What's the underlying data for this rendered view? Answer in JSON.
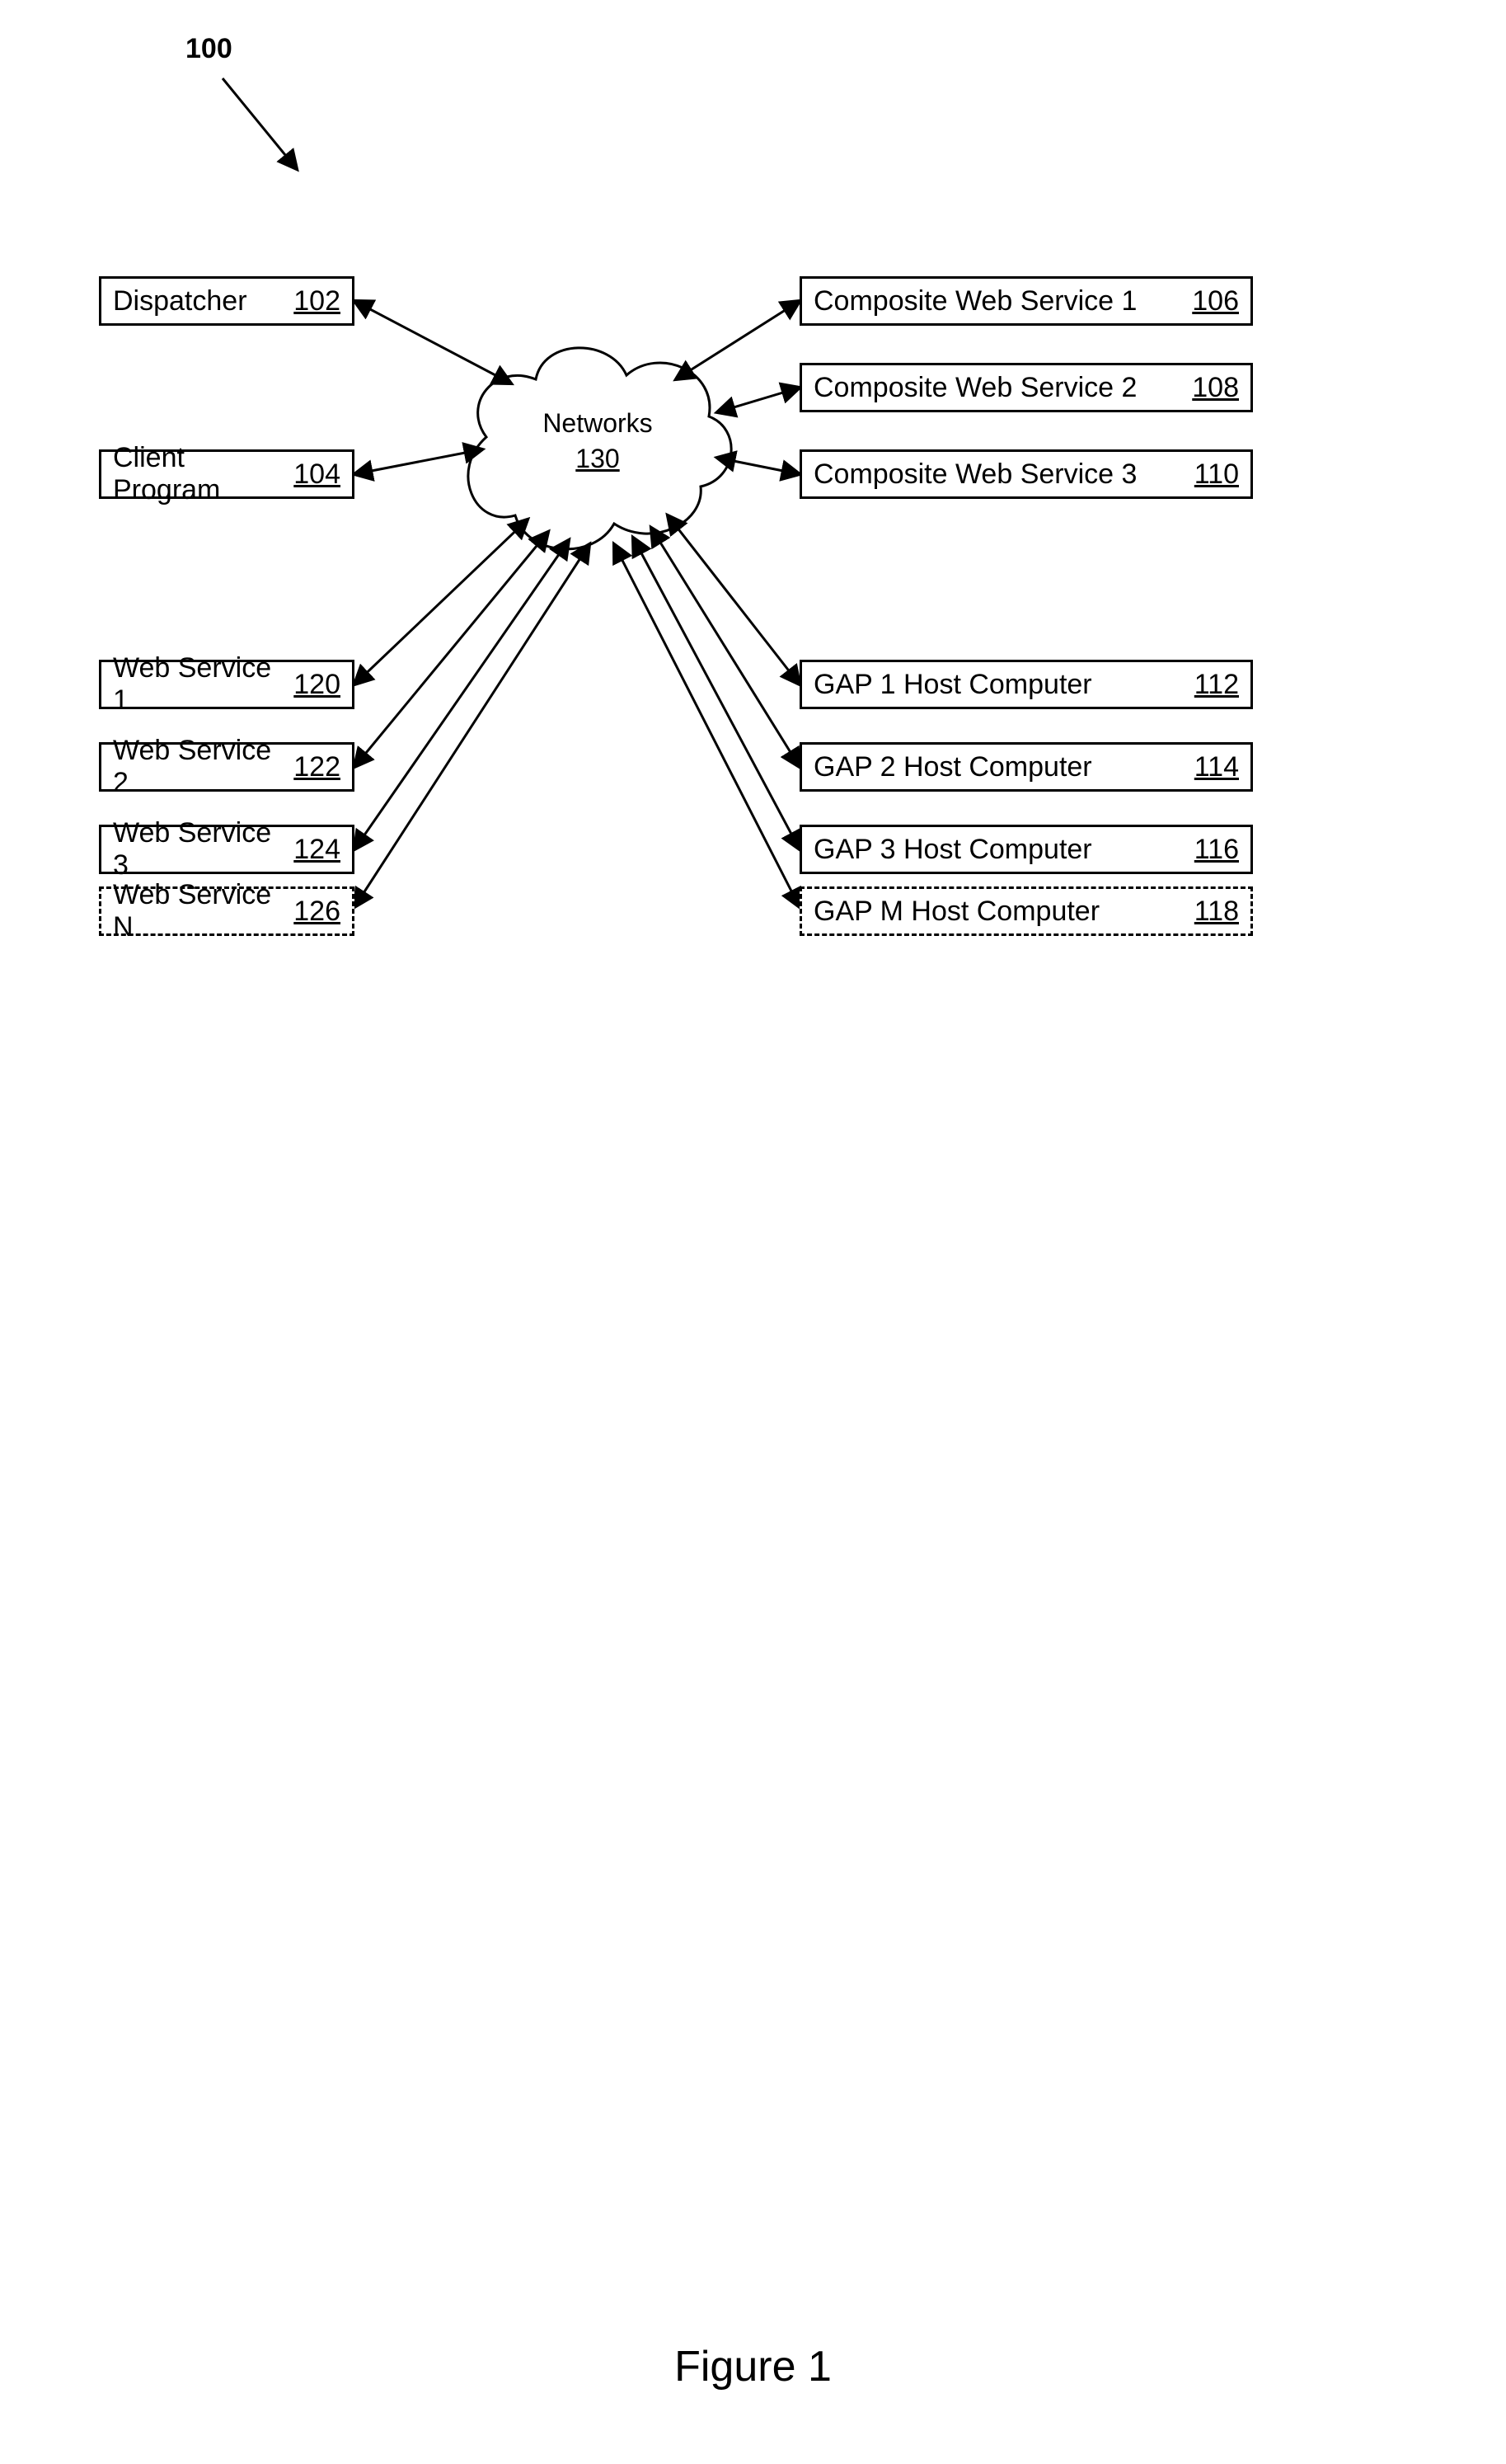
{
  "figure_number_label": "100",
  "networks": {
    "label": "Networks",
    "ref": "130"
  },
  "left_top": [
    {
      "name": "Dispatcher",
      "ref": "102"
    },
    {
      "name": "Client Program",
      "ref": "104"
    }
  ],
  "right_top": [
    {
      "name": "Composite Web Service 1",
      "ref": "106"
    },
    {
      "name": "Composite Web Service 2",
      "ref": "108"
    },
    {
      "name": "Composite Web Service 3",
      "ref": "110"
    }
  ],
  "left_bottom": [
    {
      "name": "Web Service 1",
      "ref": "120",
      "dashed": false
    },
    {
      "name": "Web Service 2",
      "ref": "122",
      "dashed": false
    },
    {
      "name": "Web Service 3",
      "ref": "124",
      "dashed": false
    },
    {
      "name": "Web Service N",
      "ref": "126",
      "dashed": true
    }
  ],
  "right_bottom": [
    {
      "name": "GAP 1 Host Computer",
      "ref": "112",
      "dashed": false
    },
    {
      "name": "GAP 2 Host Computer",
      "ref": "114",
      "dashed": false
    },
    {
      "name": "GAP 3 Host Computer",
      "ref": "116",
      "dashed": false
    },
    {
      "name": "GAP M Host Computer",
      "ref": "118",
      "dashed": true
    }
  ],
  "caption": "Figure 1"
}
